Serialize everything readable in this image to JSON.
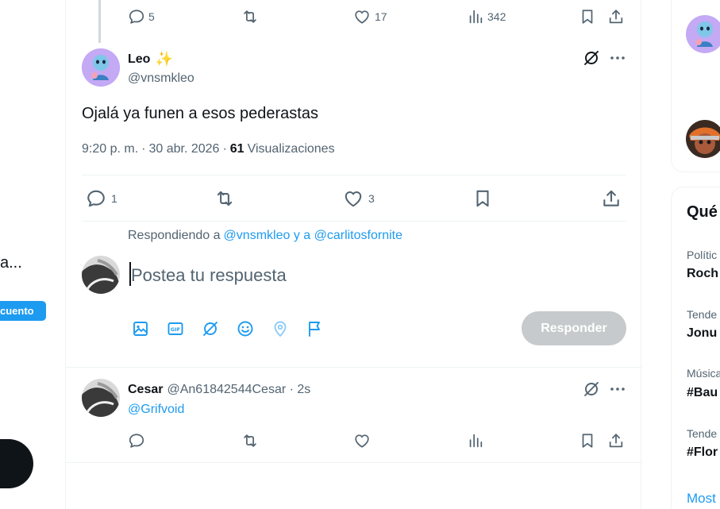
{
  "left": {
    "snippet": "a...",
    "badge": "cuento"
  },
  "top_tweet_actions": {
    "replies": "5",
    "likes": "17",
    "views": "342"
  },
  "main_tweet": {
    "name": "Leo",
    "emoji": "✨",
    "handle": "@vnsmkleo",
    "text": "Ojalá ya funen a esos pederastas",
    "time": "9:20 p. m.",
    "date": "30 abr. 2026",
    "sep": "·",
    "views_count": "61",
    "views_label": "Visualizaciones",
    "replies": "1",
    "likes": "3"
  },
  "reply_box": {
    "replying_prefix": "Respondiendo a",
    "replying_users": "@vnsmkleo y a @carlitosfornite",
    "placeholder": "Postea tu respuesta",
    "button": "Responder"
  },
  "reply_tweet": {
    "name": "Cesar",
    "handle_time": "@An61842544Cesar · 2s",
    "mention": "@Grifvoid"
  },
  "right": {
    "section_title": "Qué",
    "trends": [
      {
        "category": "Polític",
        "name": "Roch"
      },
      {
        "category": "Tende",
        "name": "Jonu"
      },
      {
        "category": "Música",
        "name": "#Bau"
      },
      {
        "category": "Tende",
        "name": "#Flor"
      }
    ],
    "show_more": "Most"
  },
  "colors": {
    "accent": "#1d9bf0",
    "text_secondary": "#536471",
    "border": "#eff3f4",
    "button_disabled": "#c6cacc"
  }
}
